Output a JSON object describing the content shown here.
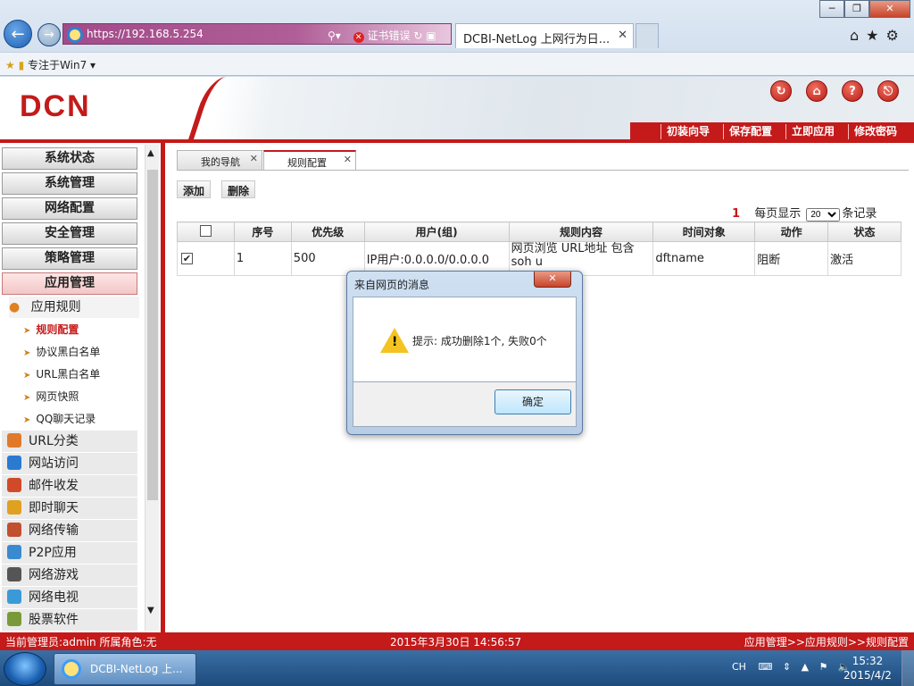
{
  "browser": {
    "url": "https://192.168.5.254",
    "cert_error": "证书错误",
    "tab_title": "DCBI-NetLog 上网行为日...",
    "fav_label": "专注于Win7"
  },
  "app": {
    "logo": "DCN",
    "top_buttons": [
      "初装向导",
      "保存配置",
      "立即应用",
      "修改密码"
    ]
  },
  "sidebar": {
    "menus": [
      "系统状态",
      "系统管理",
      "网络配置",
      "安全管理",
      "策略管理",
      "应用管理"
    ],
    "sub_header": "应用规则",
    "sub_items": [
      "规则配置",
      "协议黑白名单",
      "URL黑白名单",
      "网页快照",
      "QQ聊天记录"
    ],
    "categories": [
      "URL分类",
      "网站访问",
      "邮件收发",
      "即时聊天",
      "网络传输",
      "P2P应用",
      "网络游戏",
      "网络电视",
      "股票软件"
    ],
    "category_colors": [
      "#e07a2a",
      "#2a7ad0",
      "#d04a2a",
      "#e0a020",
      "#c05030",
      "#3a8ad0",
      "#555555",
      "#3a9ad8",
      "#7a9a3a"
    ]
  },
  "content": {
    "tabs": [
      "我的导航",
      "规则配置"
    ],
    "actions": [
      "添加",
      "删除"
    ],
    "pager": {
      "count": "1",
      "per_page_label": "每页显示",
      "per_page_value": "20",
      "records_label": "条记录"
    },
    "columns": [
      "",
      "序号",
      "优先级",
      "用户(组)",
      "规则内容",
      "时间对象",
      "动作",
      "状态"
    ],
    "rows": [
      {
        "checked": "✔",
        "index": "1",
        "priority": "500",
        "user": "IP用户:0.0.0.0/0.0.0.0",
        "rule": "网页浏览 URL地址 包含 soh u",
        "time": "dftname",
        "action": "阻断",
        "state": "激活"
      }
    ]
  },
  "dialog": {
    "title": "来自网页的消息",
    "message": "提示: 成功删除1个, 失败0个",
    "ok": "确定"
  },
  "status": {
    "admin": "当前管理员:admin  所属角色:无",
    "datetime": "2015年3月30日 14:56:57",
    "breadcrumb": "应用管理>>应用规则>>规则配置"
  },
  "taskbar": {
    "task_label": "DCBI-NetLog 上...",
    "lang": "CH",
    "time": "15:32",
    "date": "2015/4/2"
  }
}
